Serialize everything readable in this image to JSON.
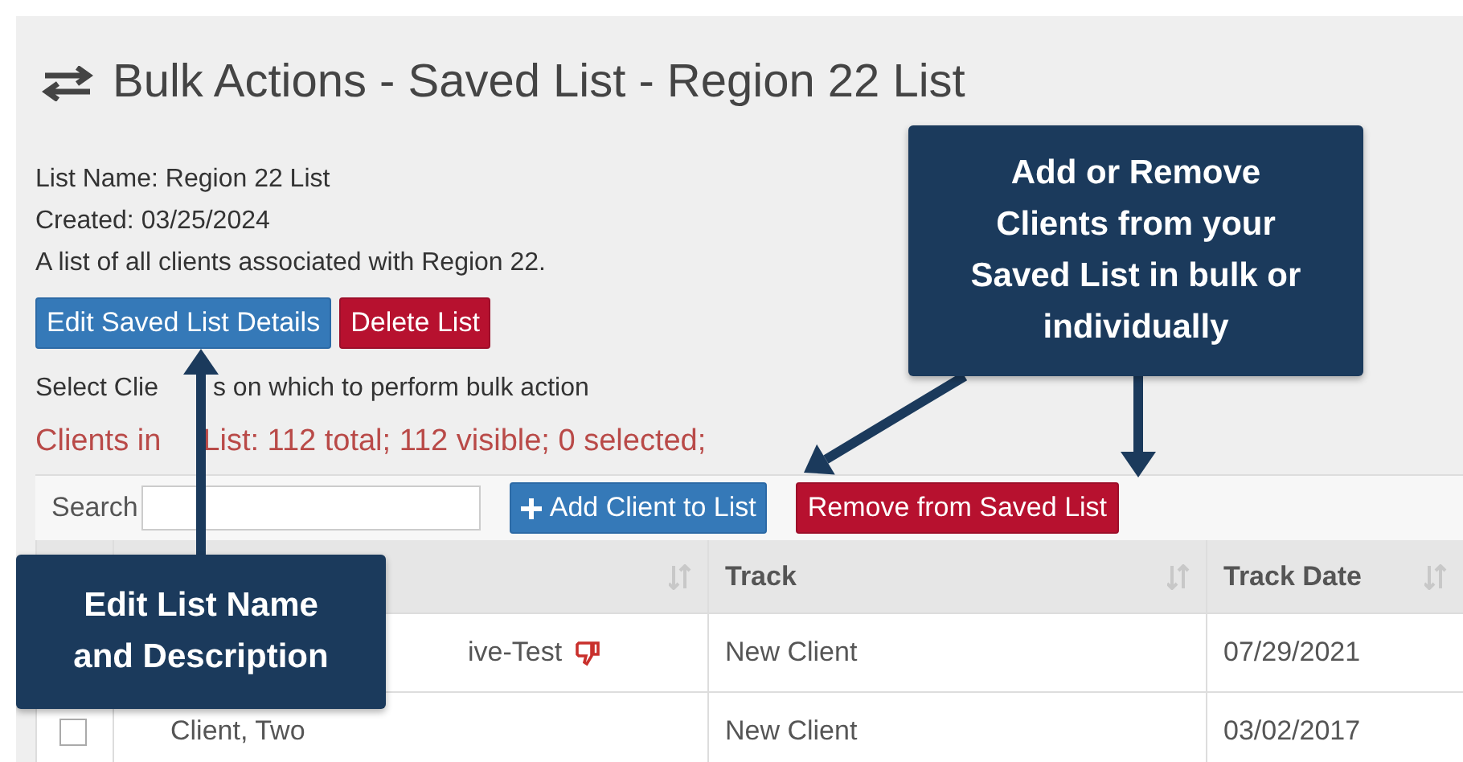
{
  "title": "Bulk Actions - Saved List - Region 22 List",
  "info": [
    "List Name: Region 22 List",
    "Created: 03/25/2024",
    "A list of all clients associated with Region 22."
  ],
  "buttons": [
    {
      "label": "Edit Saved List Details",
      "kind": "primary"
    },
    {
      "label": "Delete List",
      "kind": "danger"
    }
  ],
  "select_text": [
    "Select Clie",
    "s on which to perform bulk action"
  ],
  "summary": [
    "Clients in",
    "List: 112 total; 112 visible; 0 selected;"
  ],
  "toolbar": {
    "search_label": "Search",
    "actions": [
      {
        "label": "Add Client to List",
        "kind": "primary"
      },
      {
        "label": "Remove from Saved List",
        "kind": "danger"
      }
    ]
  },
  "table": {
    "columns": [
      {
        "label": "Track"
      },
      {
        "label": "Track Date"
      }
    ],
    "rows": [
      {
        "name": "ive-Test",
        "flagged": true,
        "covered": true,
        "track": "New Client",
        "date": "07/29/2021"
      },
      {
        "name": "Client, Two",
        "flagged": false,
        "covered": false,
        "track": "New Client",
        "date": "03/02/2017",
        "checked": false
      }
    ]
  },
  "callouts": [
    {
      "lines": [
        "Add or Remove",
        "Clients from your",
        "Saved List in bulk or",
        "individually"
      ]
    },
    {
      "lines": [
        "Edit List Name",
        "and Description"
      ]
    }
  ]
}
